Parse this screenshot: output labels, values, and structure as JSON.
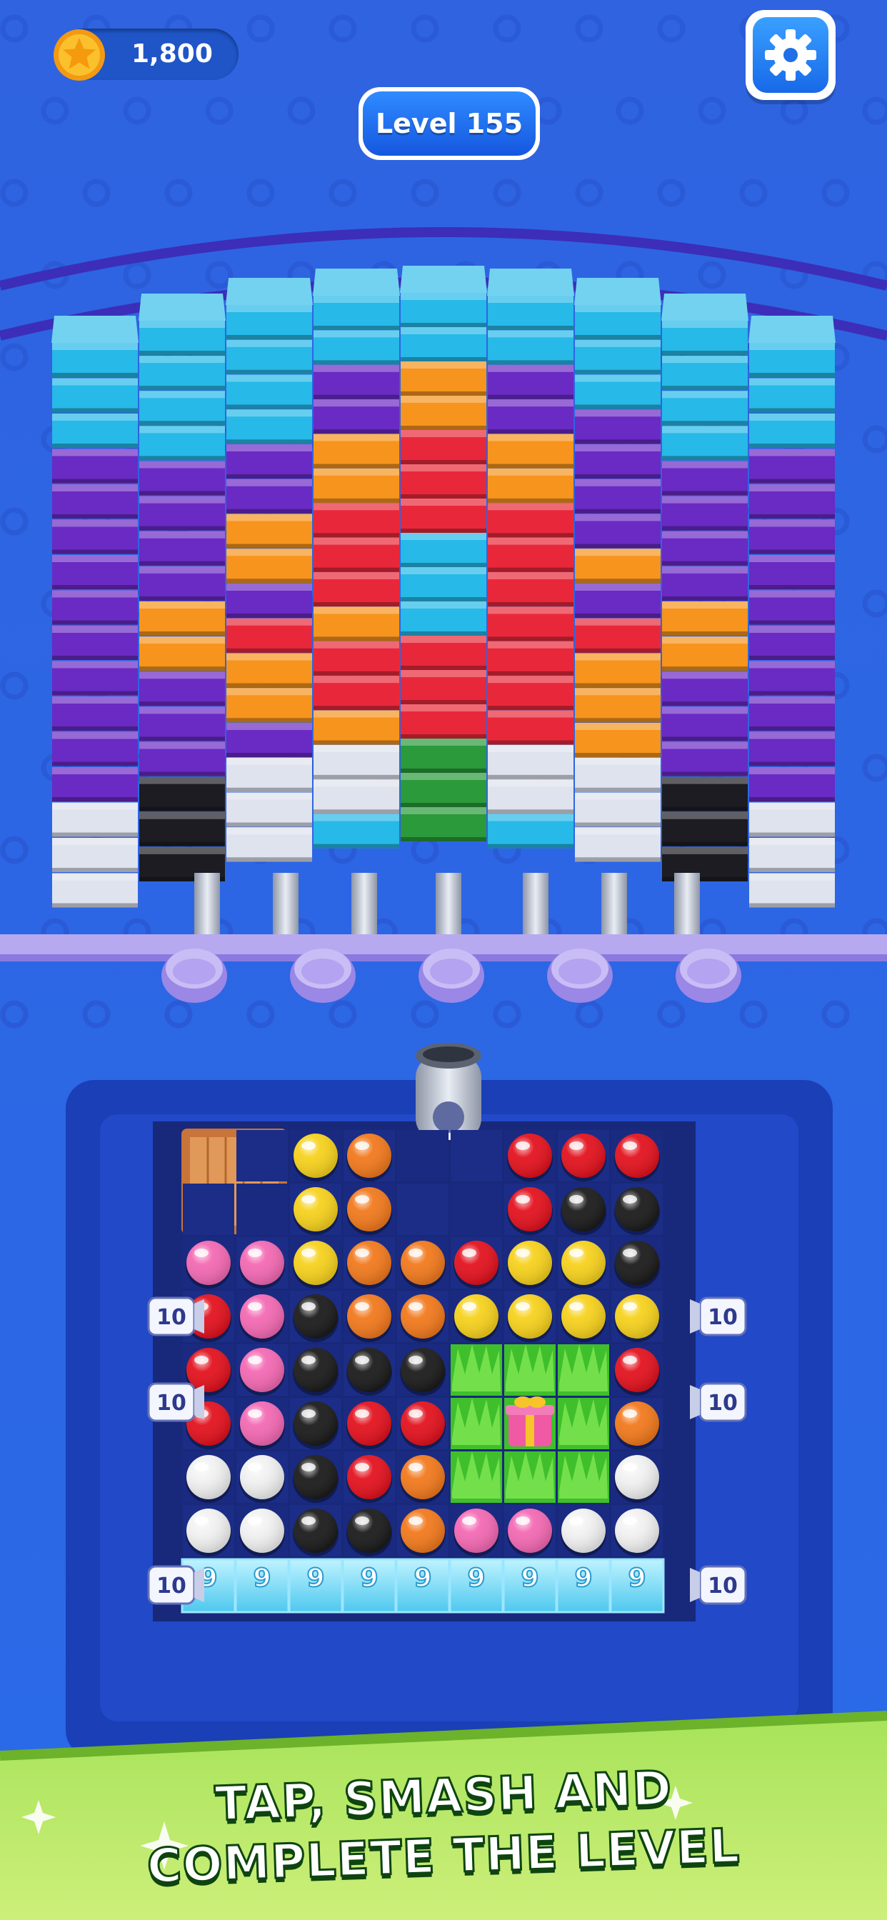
{
  "hud": {
    "coins": "1,800",
    "level_label": "Level 155",
    "coin_icon": "star-coin-icon",
    "settings_icon": "gear-icon"
  },
  "banner": {
    "line1": "TAP, SMASH AND",
    "line2": "COMPLETE THE LEVEL"
  },
  "colors": {
    "cyan": "#27b9e8",
    "purple": "#6a2ac4",
    "orange": "#f7941d",
    "red": "#e8283a",
    "white": "#dfe3ee",
    "black": "#1c1c22",
    "green": "#2a9a3a",
    "ball_yellow": "#f7d21e",
    "ball_orange": "#f27a1e",
    "ball_red": "#e3131f",
    "ball_pink": "#f46ab4",
    "ball_black": "#1c1c1c",
    "ball_white": "#f2f2f2"
  },
  "wall": {
    "columns": 9,
    "rows": 16,
    "grid": [
      "CCCCCCCCC",
      "CCCCCCCCC",
      "CCCPOPCCC",
      "PCCPOPPCP",
      "PPPOROPPP",
      "PPPOROPPP",
      "PPORRRPPP",
      "PPORCROPP",
      "POPRCRPOP",
      "POROCRROP",
      "PPORRROPP",
      "PPORRROPP",
      "PPPORROPP",
      "WBWWGWWBW",
      "WBWWGWWBW",
      "WBWCGCWBW"
    ]
  },
  "board": {
    "columns": 9,
    "rows": 7,
    "cells": [
      [
        "crate",
        "crate",
        "Y",
        "O",
        "_",
        "_",
        "R",
        "R",
        "R"
      ],
      [
        "crate",
        "crate",
        "Y",
        "O",
        "_",
        "_",
        "R",
        "K",
        "K"
      ],
      [
        "P",
        "P",
        "Y",
        "O",
        "O",
        "R",
        "Y",
        "Y",
        "K"
      ],
      [
        "R",
        "P",
        "K",
        "O",
        "O",
        "Y",
        "Y",
        "Y",
        "Y"
      ],
      [
        "R",
        "P",
        "K",
        "K",
        "K",
        "grass",
        "grass",
        "grass",
        "R"
      ],
      [
        "R",
        "P",
        "K",
        "R",
        "R",
        "grass",
        "gift",
        "grass",
        "O"
      ],
      [
        "W",
        "W",
        "K",
        "R",
        "O",
        "grass",
        "grass",
        "grass",
        "W"
      ],
      [
        "W",
        "W",
        "K",
        "K",
        "O",
        "P",
        "P",
        "W",
        "W"
      ]
    ],
    "ice_row": [
      "9",
      "9",
      "9",
      "9",
      "9",
      "9",
      "9",
      "9",
      "9"
    ],
    "side_counters_left": [
      "10",
      "10",
      "10"
    ],
    "side_counters_right": [
      "10",
      "10",
      "10"
    ]
  }
}
